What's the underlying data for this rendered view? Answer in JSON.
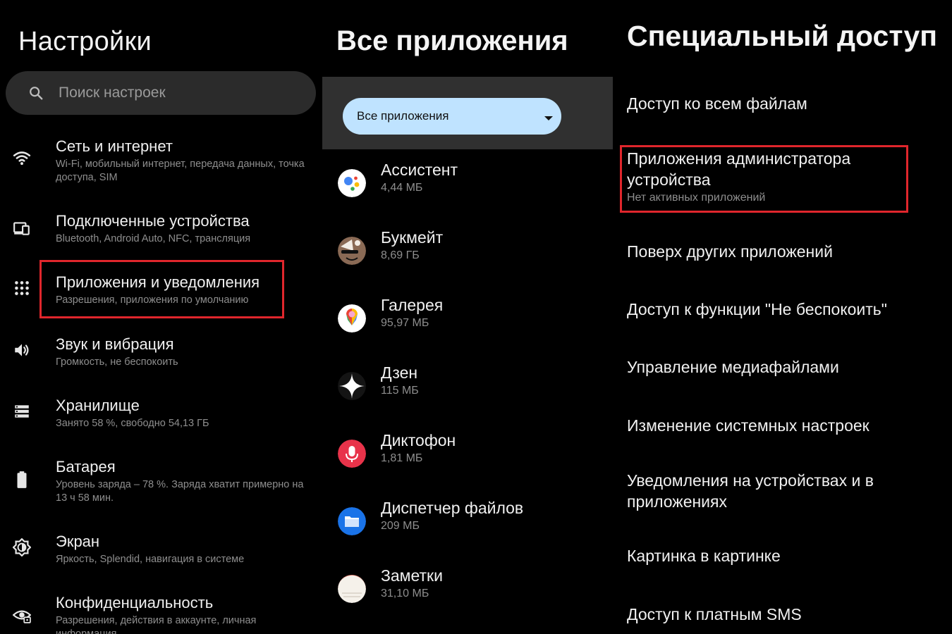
{
  "settings": {
    "title": "Настройки",
    "search_placeholder": "Поиск настроек",
    "items": [
      {
        "title": "Сеть и интернет",
        "subtitle": "Wi-Fi, мобильный интернет, передача данных, точка доступа, SIM",
        "icon": "wifi-icon"
      },
      {
        "title": "Подключенные устройства",
        "subtitle": "Bluetooth, Android Auto, NFC, трансляция",
        "icon": "devices-icon"
      },
      {
        "title": "Приложения и уведомления",
        "subtitle": "Разрешения, приложения по умолчанию",
        "icon": "apps-grid-icon"
      },
      {
        "title": "Звук и вибрация",
        "subtitle": "Громкость, не беспокоить",
        "icon": "volume-icon"
      },
      {
        "title": "Хранилище",
        "subtitle": "Занято 58 %, свободно 54,13 ГБ",
        "icon": "storage-icon"
      },
      {
        "title": "Батарея",
        "subtitle": "Уровень заряда – 78 %. Заряда хватит примерно на 13 ч 58 мин.",
        "icon": "battery-icon"
      },
      {
        "title": "Экран",
        "subtitle": "Яркость, Splendid, навигация в системе",
        "icon": "brightness-icon"
      },
      {
        "title": "Конфиденциальность",
        "subtitle": "Разрешения, действия в аккаунте, личная информация",
        "icon": "privacy-eye-icon"
      }
    ]
  },
  "apps": {
    "title": "Все приложения",
    "filter_label": "Все приложения",
    "list": [
      {
        "name": "Ассистент",
        "size": "4,44 МБ",
        "icon": "assistant-icon"
      },
      {
        "name": "Букмейт",
        "size": "8,69 ГБ",
        "icon": "bookmate-icon"
      },
      {
        "name": "Галерея",
        "size": "95,97 МБ",
        "icon": "gallery-icon"
      },
      {
        "name": "Дзен",
        "size": "115 МБ",
        "icon": "zen-icon"
      },
      {
        "name": "Диктофон",
        "size": "1,81 МБ",
        "icon": "recorder-icon"
      },
      {
        "name": "Диспетчер файлов",
        "size": "209 МБ",
        "icon": "files-icon"
      },
      {
        "name": "Заметки",
        "size": "31,10 МБ",
        "icon": "notes-icon"
      }
    ]
  },
  "special": {
    "title": "Специальный доступ",
    "items": [
      {
        "title": "Доступ ко всем файлам"
      },
      {
        "title": "Приложения администратора устройства",
        "subtitle": "Нет активных приложений"
      },
      {
        "title": "Поверх других приложений"
      },
      {
        "title": "Доступ к функции \"Не беспокоить\""
      },
      {
        "title": "Управление медиафайлами"
      },
      {
        "title": "Изменение системных настроек"
      },
      {
        "title": "Уведомления на устройствах и в приложениях"
      },
      {
        "title": "Картинка в картинке"
      },
      {
        "title": "Доступ к платным SMS"
      }
    ]
  },
  "colors": {
    "background": "#000000",
    "highlight": "#e0262c",
    "filter_chip": "#bfe3ff",
    "secondary_text": "#8e8e8e"
  }
}
